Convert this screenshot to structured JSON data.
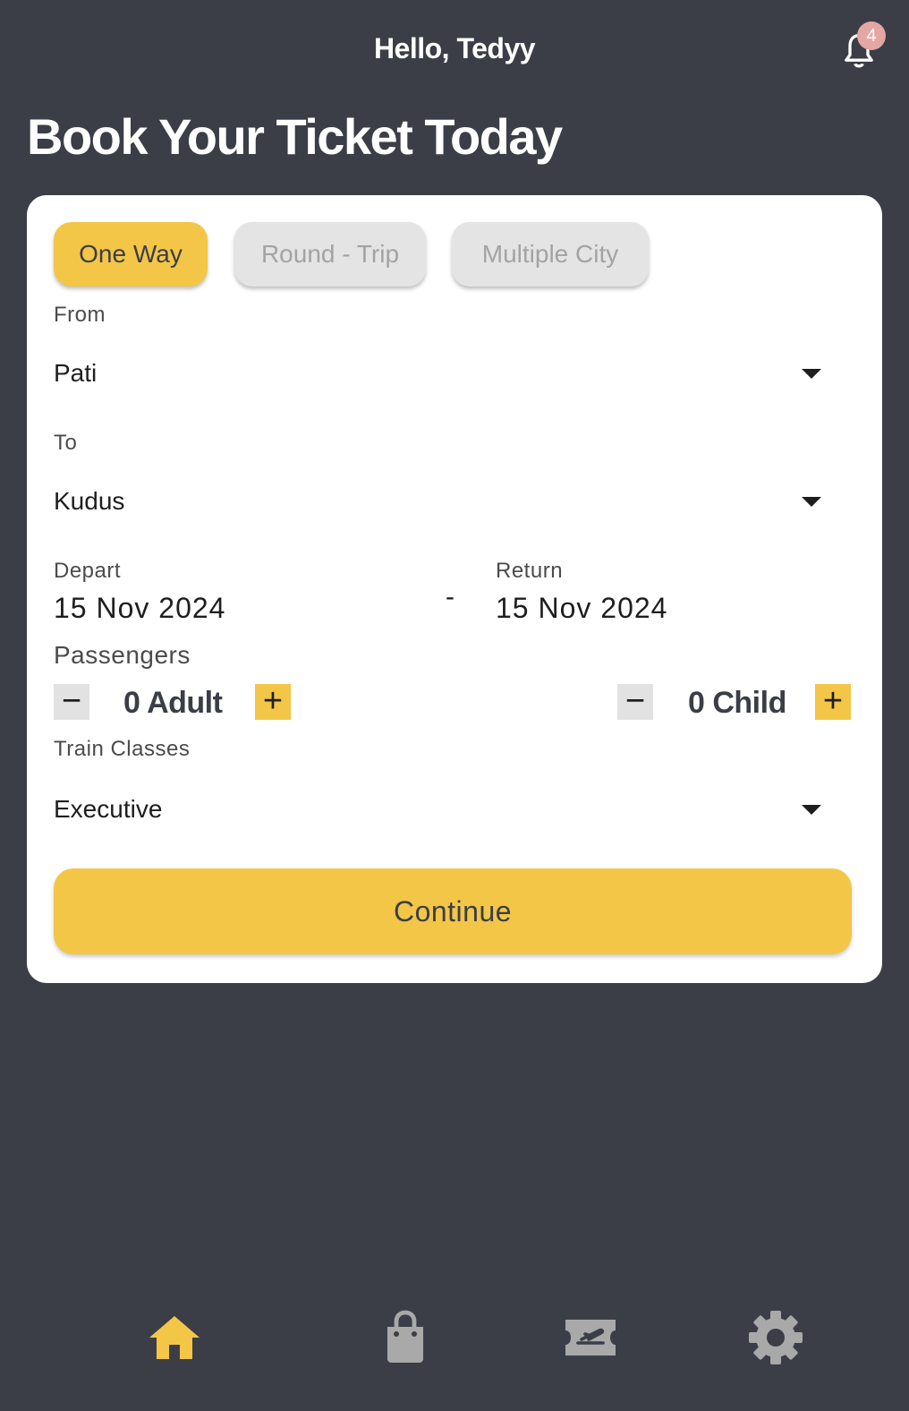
{
  "header": {
    "greeting": "Hello, Tedyy",
    "notification_count": "4",
    "title": "Book Your Ticket Today"
  },
  "trip_tabs": [
    {
      "label": "One Way",
      "active": true
    },
    {
      "label": "Round - Trip",
      "active": false
    },
    {
      "label": "Multiple City",
      "active": false
    }
  ],
  "form": {
    "from_label": "From",
    "from_value": "Pati",
    "to_label": "To",
    "to_value": "Kudus",
    "depart_label": "Depart",
    "depart_value": "15 Nov 2024",
    "date_separator": "-",
    "return_label": "Return",
    "return_value": "15 Nov 2024",
    "passengers_label": "Passengers",
    "adult_count": "0 Adult",
    "child_count": "0 Child",
    "class_label": "Train Classes",
    "class_value": "Executive",
    "minus_glyph": "−",
    "plus_glyph": "+"
  },
  "continue_label": "Continue",
  "bottom_nav": [
    {
      "icon": "home-icon",
      "active": true
    },
    {
      "icon": "shopping-bag-icon",
      "active": false
    },
    {
      "icon": "ticket-icon",
      "active": false
    },
    {
      "icon": "settings-gear-icon",
      "active": false
    }
  ],
  "colors": {
    "background": "#3b3e47",
    "accent": "#f4c647",
    "card": "#ffffff",
    "inactive_tab": "#e4e4e4",
    "inactive_icon": "#a9a9a9",
    "badge": "#e5a7a3"
  }
}
